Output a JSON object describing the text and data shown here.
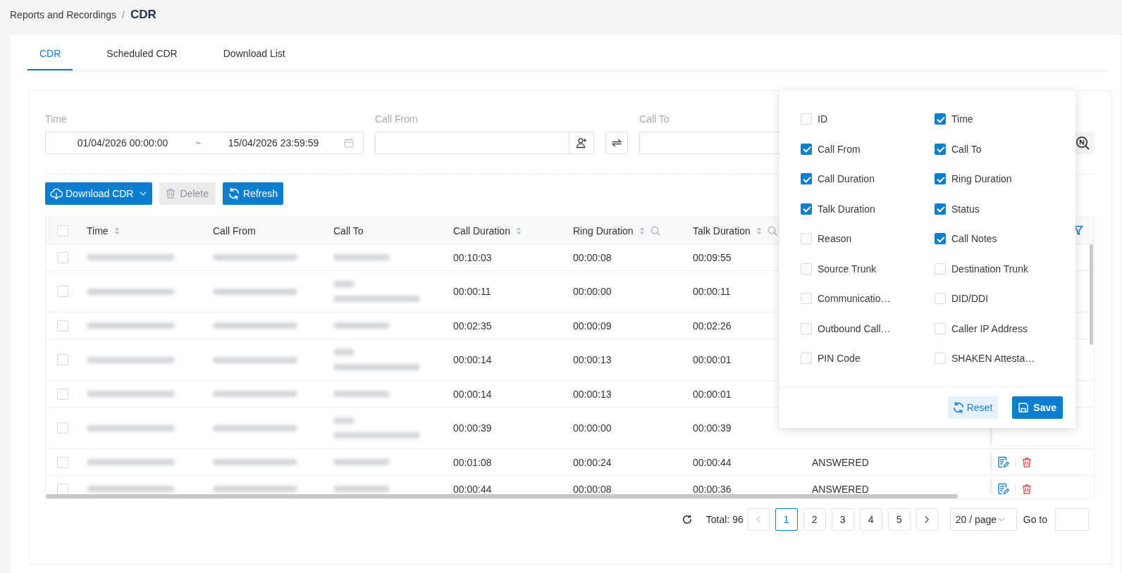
{
  "breadcrumb": {
    "parent": "Reports and Recordings",
    "separator": "/",
    "current": "CDR"
  },
  "tabs": [
    {
      "label": "CDR",
      "selected": true
    },
    {
      "label": "Scheduled CDR",
      "selected": false
    },
    {
      "label": "Download List",
      "selected": false
    }
  ],
  "filters": {
    "time": {
      "label": "Time",
      "start": "01/04/2026 00:00:00",
      "separator": "~",
      "end": "15/04/2026 23:59:59"
    },
    "call_from": {
      "label": "Call From"
    },
    "call_to": {
      "label": "Call To"
    }
  },
  "toolbar": [
    {
      "kind": "download",
      "label": "Download CDR",
      "disabled": false
    },
    {
      "kind": "delete",
      "label": "Delete",
      "disabled": true
    },
    {
      "kind": "refresh",
      "label": "Refresh",
      "disabled": false
    }
  ],
  "table": {
    "all_checked": false,
    "columns": [
      {
        "label": "Time",
        "sortable": true,
        "searchable": false
      },
      {
        "label": "Call From",
        "sortable": false,
        "searchable": false
      },
      {
        "label": "Call To",
        "sortable": false,
        "searchable": false
      },
      {
        "label": "Call Duration",
        "sortable": true,
        "searchable": false
      },
      {
        "label": "Ring Duration",
        "sortable": true,
        "searchable": true
      },
      {
        "label": "Talk Duration",
        "sortable": true,
        "searchable": true
      }
    ],
    "rows": [
      {
        "kind": "single",
        "checked": false,
        "call_duration": "00:10:03",
        "ring_duration": "00:00:08",
        "talk_duration": "00:09:55"
      },
      {
        "kind": "double",
        "checked": false,
        "call_duration": "00:00:11",
        "ring_duration": "00:00:00",
        "talk_duration": "00:00:11"
      },
      {
        "kind": "single",
        "checked": false,
        "call_duration": "00:02:35",
        "ring_duration": "00:00:09",
        "talk_duration": "00:02:26"
      },
      {
        "kind": "double",
        "checked": false,
        "call_duration": "00:00:14",
        "ring_duration": "00:00:13",
        "talk_duration": "00:00:01"
      },
      {
        "kind": "single",
        "checked": false,
        "call_duration": "00:00:14",
        "ring_duration": "00:00:13",
        "talk_duration": "00:00:01"
      },
      {
        "kind": "double",
        "checked": false,
        "call_duration": "00:00:39",
        "ring_duration": "00:00:00",
        "talk_duration": "00:00:39"
      },
      {
        "kind": "single",
        "checked": false,
        "call_duration": "00:01:08",
        "ring_duration": "00:00:24",
        "talk_duration": "00:00:44",
        "status": "ANSWERED",
        "actions_visible": true
      },
      {
        "kind": "single",
        "checked": false,
        "call_duration": "00:00:44",
        "ring_duration": "00:00:08",
        "talk_duration": "00:00:36",
        "status": "ANSWERED",
        "actions_visible": true
      }
    ]
  },
  "column_picker": {
    "options": [
      {
        "label": "ID",
        "checked": false
      },
      {
        "label": "Time",
        "checked": true
      },
      {
        "label": "Call From",
        "checked": true
      },
      {
        "label": "Call To",
        "checked": true
      },
      {
        "label": "Call Duration",
        "checked": true
      },
      {
        "label": "Ring Duration",
        "checked": true
      },
      {
        "label": "Talk Duration",
        "checked": true
      },
      {
        "label": "Status",
        "checked": true
      },
      {
        "label": "Reason",
        "checked": false
      },
      {
        "label": "Call Notes",
        "checked": true
      },
      {
        "label": "Source Trunk",
        "checked": false
      },
      {
        "label": "Destination Trunk",
        "checked": false
      },
      {
        "label": "Communicatio…",
        "checked": false
      },
      {
        "label": "DID/DDI",
        "checked": false
      },
      {
        "label": "Outbound Call…",
        "checked": false
      },
      {
        "label": "Caller IP Address",
        "checked": false
      },
      {
        "label": "PIN Code",
        "checked": false
      },
      {
        "label": "SHAKEN Attesta…",
        "checked": false
      }
    ],
    "buttons": [
      {
        "kind": "reset",
        "label": "Reset"
      },
      {
        "kind": "save",
        "label": "Save"
      }
    ]
  },
  "pagination": {
    "total": "Total: 96",
    "prev": {
      "disabled": true
    },
    "pages": [
      {
        "label": "1",
        "selected": true
      },
      {
        "label": "2",
        "selected": false
      },
      {
        "label": "3",
        "selected": false
      },
      {
        "label": "4",
        "selected": false
      },
      {
        "label": "5",
        "selected": false
      }
    ],
    "next": {
      "disabled": false
    },
    "page_size": "20 / page",
    "go_to": "Go to"
  }
}
